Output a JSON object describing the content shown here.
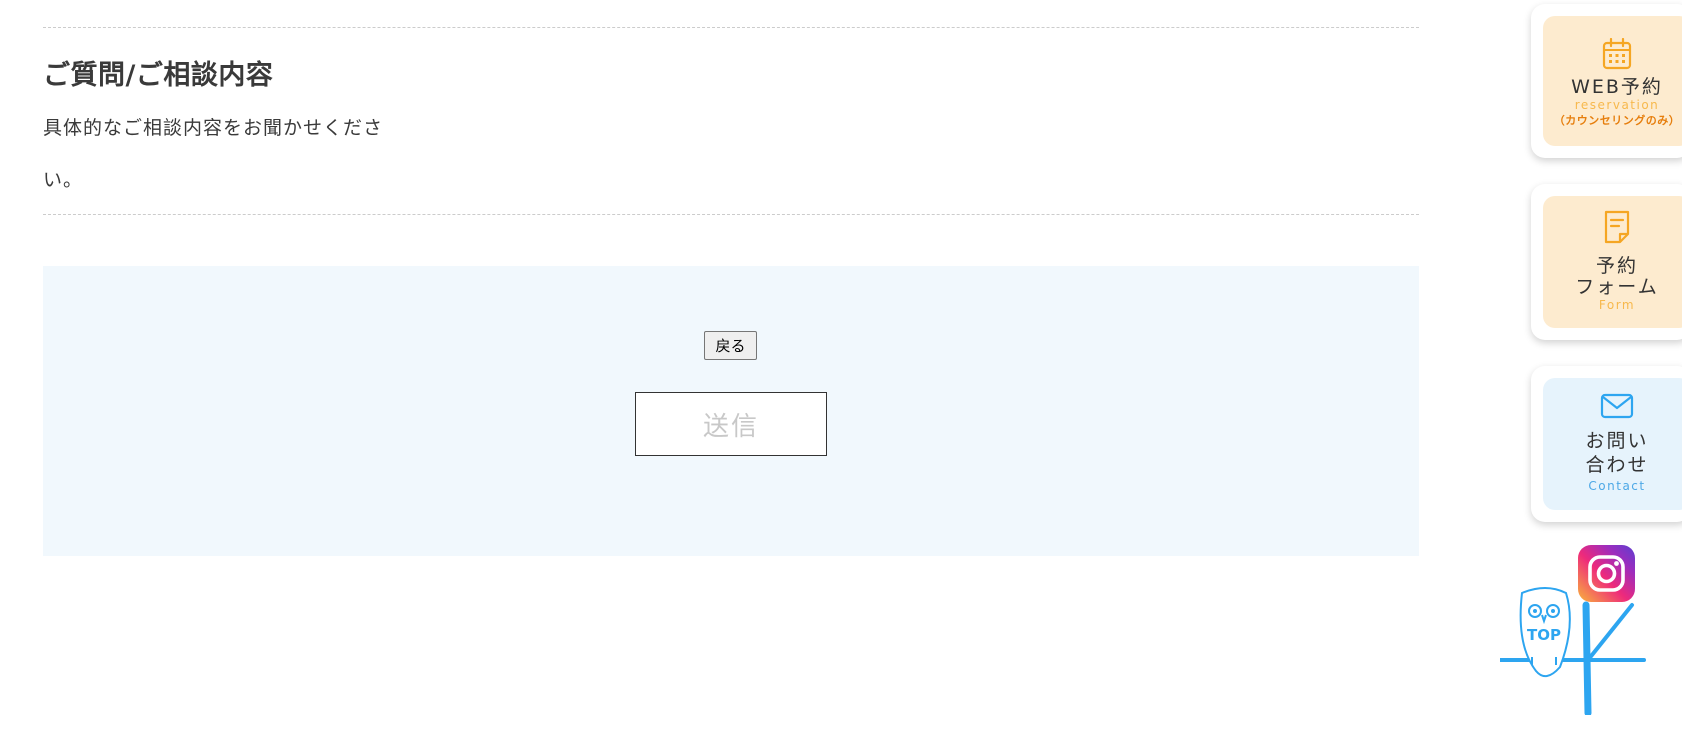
{
  "section": {
    "title": "ご質問/ご相談内容",
    "body": "具体的なご相談内容をお聞かせください。"
  },
  "form": {
    "back_label": "戻る",
    "submit_label": "送信"
  },
  "side_nav": {
    "web_reservation": {
      "label": "WEB予約",
      "sub": "reservation",
      "note": "（カウンセリングのみ）",
      "icon": "calendar-icon"
    },
    "reservation_form": {
      "label_line1": "予約",
      "label_line2": "フォーム",
      "sub": "Form",
      "icon": "document-icon"
    },
    "contact": {
      "label_line1": "お問い",
      "label_line2": "合わせ",
      "sub": "Contact",
      "icon": "mail-icon"
    },
    "instagram": {
      "icon": "instagram-icon"
    },
    "top": {
      "label": "TOP",
      "icon": "owl-icon"
    }
  },
  "colors": {
    "orange_accent": "#f5a623",
    "blue_accent": "#2da5f0",
    "form_bg": "#f1f8fd"
  }
}
